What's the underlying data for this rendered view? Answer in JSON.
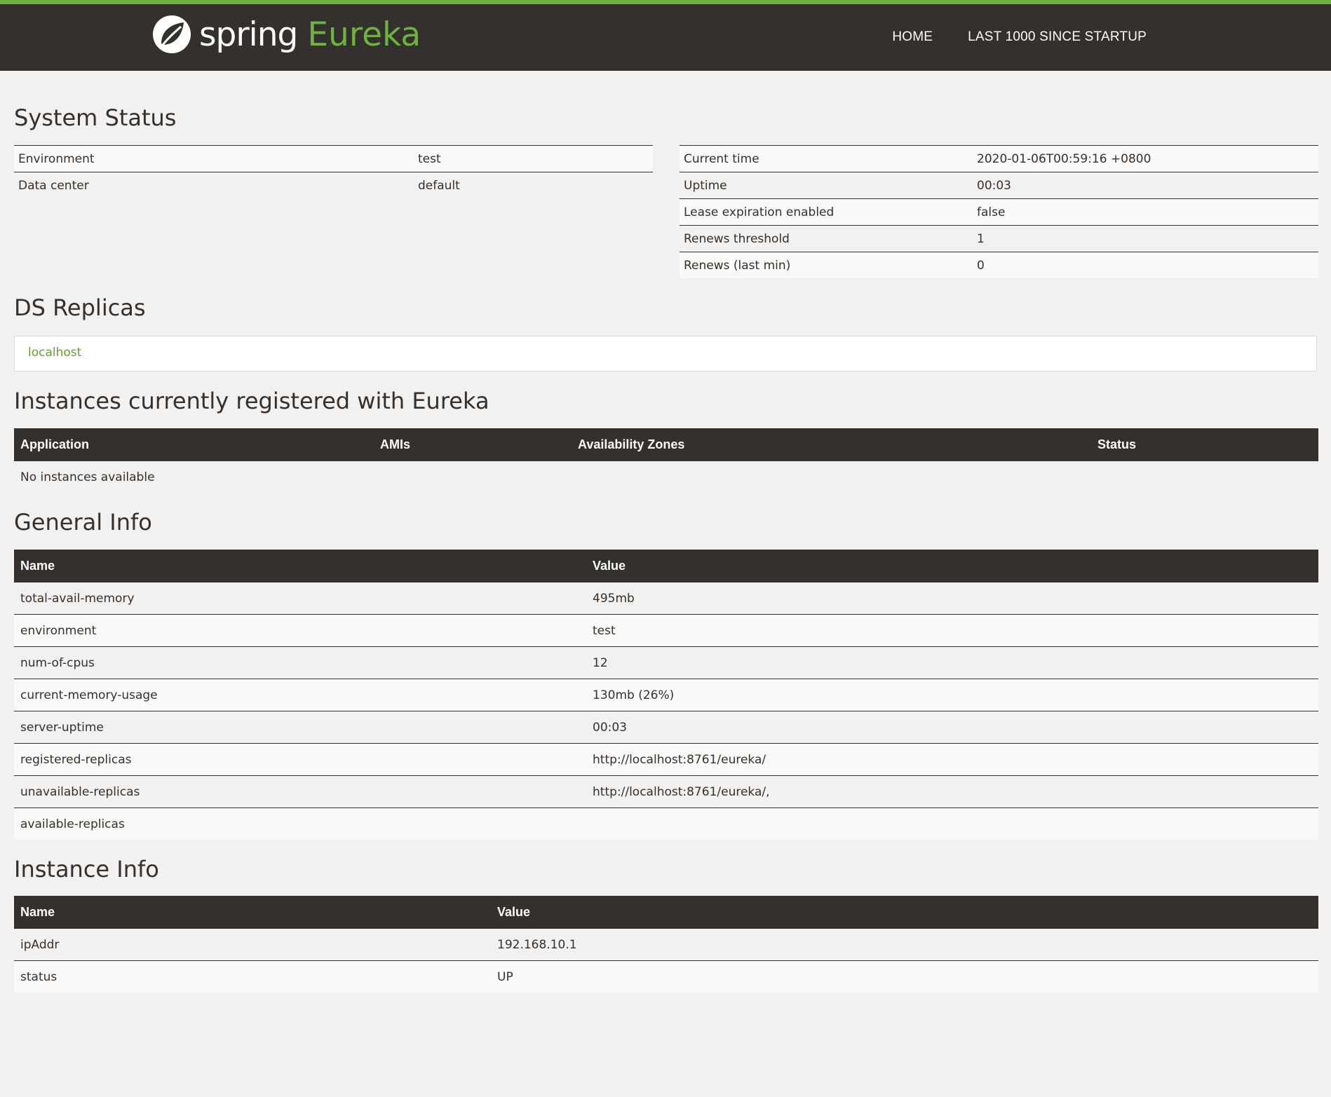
{
  "header": {
    "brand_word1": "spring",
    "brand_word2": "Eureka",
    "nav": [
      "HOME",
      "LAST 1000 SINCE STARTUP"
    ]
  },
  "system_status": {
    "title": "System Status",
    "left": [
      {
        "label": "Environment",
        "value": "test"
      },
      {
        "label": "Data center",
        "value": "default"
      }
    ],
    "right": [
      {
        "label": "Current time",
        "value": "2020-01-06T00:59:16 +0800"
      },
      {
        "label": "Uptime",
        "value": "00:03"
      },
      {
        "label": "Lease expiration enabled",
        "value": "false"
      },
      {
        "label": "Renews threshold",
        "value": "1"
      },
      {
        "label": "Renews (last min)",
        "value": "0"
      }
    ]
  },
  "ds_replicas": {
    "title": "DS Replicas",
    "items": [
      "localhost"
    ]
  },
  "instances": {
    "title": "Instances currently registered with Eureka",
    "columns": [
      "Application",
      "AMIs",
      "Availability Zones",
      "Status"
    ],
    "empty_text": "No instances available"
  },
  "general_info": {
    "title": "General Info",
    "columns": [
      "Name",
      "Value"
    ],
    "rows": [
      {
        "name": "total-avail-memory",
        "value": "495mb"
      },
      {
        "name": "environment",
        "value": "test"
      },
      {
        "name": "num-of-cpus",
        "value": "12"
      },
      {
        "name": "current-memory-usage",
        "value": "130mb (26%)"
      },
      {
        "name": "server-uptime",
        "value": "00:03"
      },
      {
        "name": "registered-replicas",
        "value": "http://localhost:8761/eureka/"
      },
      {
        "name": "unavailable-replicas",
        "value": "http://localhost:8761/eureka/,"
      },
      {
        "name": "available-replicas",
        "value": ""
      }
    ]
  },
  "instance_info": {
    "title": "Instance Info",
    "columns": [
      "Name",
      "Value"
    ],
    "rows": [
      {
        "name": "ipAddr",
        "value": "192.168.10.1"
      },
      {
        "name": "status",
        "value": "UP"
      }
    ]
  },
  "colors": {
    "accent": "#6db33f",
    "header_bg": "#34302d",
    "page_bg": "#f1f1f1"
  }
}
